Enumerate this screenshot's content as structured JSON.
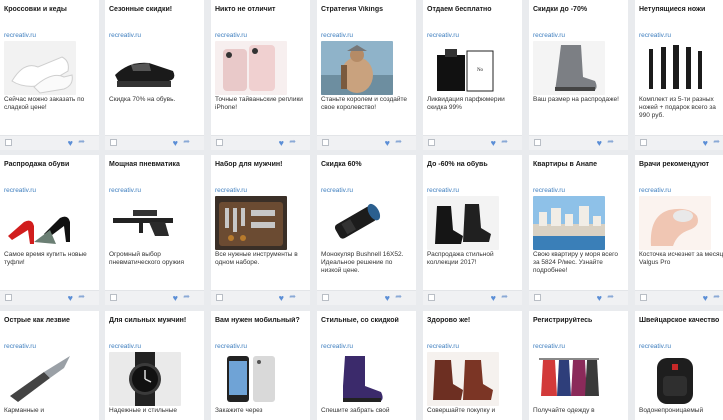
{
  "domain_label": "recreativ.ru",
  "colors": {
    "background": "#e9ebee",
    "card": "#ffffff",
    "domain_link": "#3f7fbf",
    "heart": "#5b8ed6"
  },
  "icons": {
    "like": "heart-icon",
    "share": "share-icon",
    "select": "checkbox"
  },
  "rows": [
    [
      {
        "title": "Кроссовки и кеды",
        "desc": "Сейчас можно заказать по сладкой цене!",
        "image": "white-sneakers"
      },
      {
        "title": "Сезонные скидки!",
        "desc": "Скидка 70% на обувь.",
        "image": "black-platform-shoe"
      },
      {
        "title": "Никто не отличит",
        "desc": "Точные тайваньские реплики iPhone!",
        "image": "pink-phones"
      },
      {
        "title": "Стратегия Vikings",
        "desc": "Станьте королем и создайте свое королевство!",
        "image": "viking-warrior"
      },
      {
        "title": "Отдаем бесплатно",
        "desc": "Ликвидация парфюмерии скидка 99%",
        "image": "perfume-bottle"
      },
      {
        "title": "Скидки до -70%",
        "desc": "Ваш размер на распродаже!",
        "image": "grey-boot"
      },
      {
        "title": "Нетупящиеся ножи",
        "desc": "Комплект из 5-ти разных ножей + подарок всего за 990 руб.",
        "image": "knife-set"
      }
    ],
    [
      {
        "title": "Распродажа обуви",
        "desc": "Самое время купить новые туфли!",
        "image": "red-heels"
      },
      {
        "title": "Мощная пневматика",
        "desc": "Огромный выбор пневматического оружия",
        "image": "air-rifle"
      },
      {
        "title": "Набор для мужчин!",
        "desc": "Все нужные инструменты в одном наборе.",
        "image": "tool-case"
      },
      {
        "title": "Скидка 60%",
        "desc": "Монокуляр Bushnell 16X52. Идеальное решение по низкой цене.",
        "image": "monocular"
      },
      {
        "title": "До -60% на обувь",
        "desc": "Распродажа стильной коллекции 2017!",
        "image": "black-ankle-boots"
      },
      {
        "title": "Квартиры в Анапе",
        "desc": "Свою квартиру у моря всего за 5824 Р/мес. Узнайте подробнее!",
        "image": "seaside-city"
      },
      {
        "title": "Врачи рекомендуют",
        "desc": "Косточка исчезнет за месяц! Valgus Pro",
        "image": "foot-corrector"
      }
    ],
    [
      {
        "title": "Острые как лезвие",
        "desc": "Карманные и",
        "image": "pocket-knife"
      },
      {
        "title": "Для сильных мужчин!",
        "desc": "Надежные и стильные",
        "image": "wrist-watch"
      },
      {
        "title": "Вам нужен мобильный?",
        "desc": "Закажите через",
        "image": "iphone"
      },
      {
        "title": "Стильные, со скидкой",
        "desc": "Спешите забрать свой",
        "image": "purple-boot"
      },
      {
        "title": "Здорово же!",
        "desc": "Совершайте покупку и",
        "image": "brown-chelsea-boots"
      },
      {
        "title": "Регистрируйтесь",
        "desc": "Получайте одежду в",
        "image": "clothing-rack"
      },
      {
        "title": "Швейцарское качество",
        "desc": "Водонепроницаемый",
        "image": "black-backpack"
      }
    ]
  ]
}
